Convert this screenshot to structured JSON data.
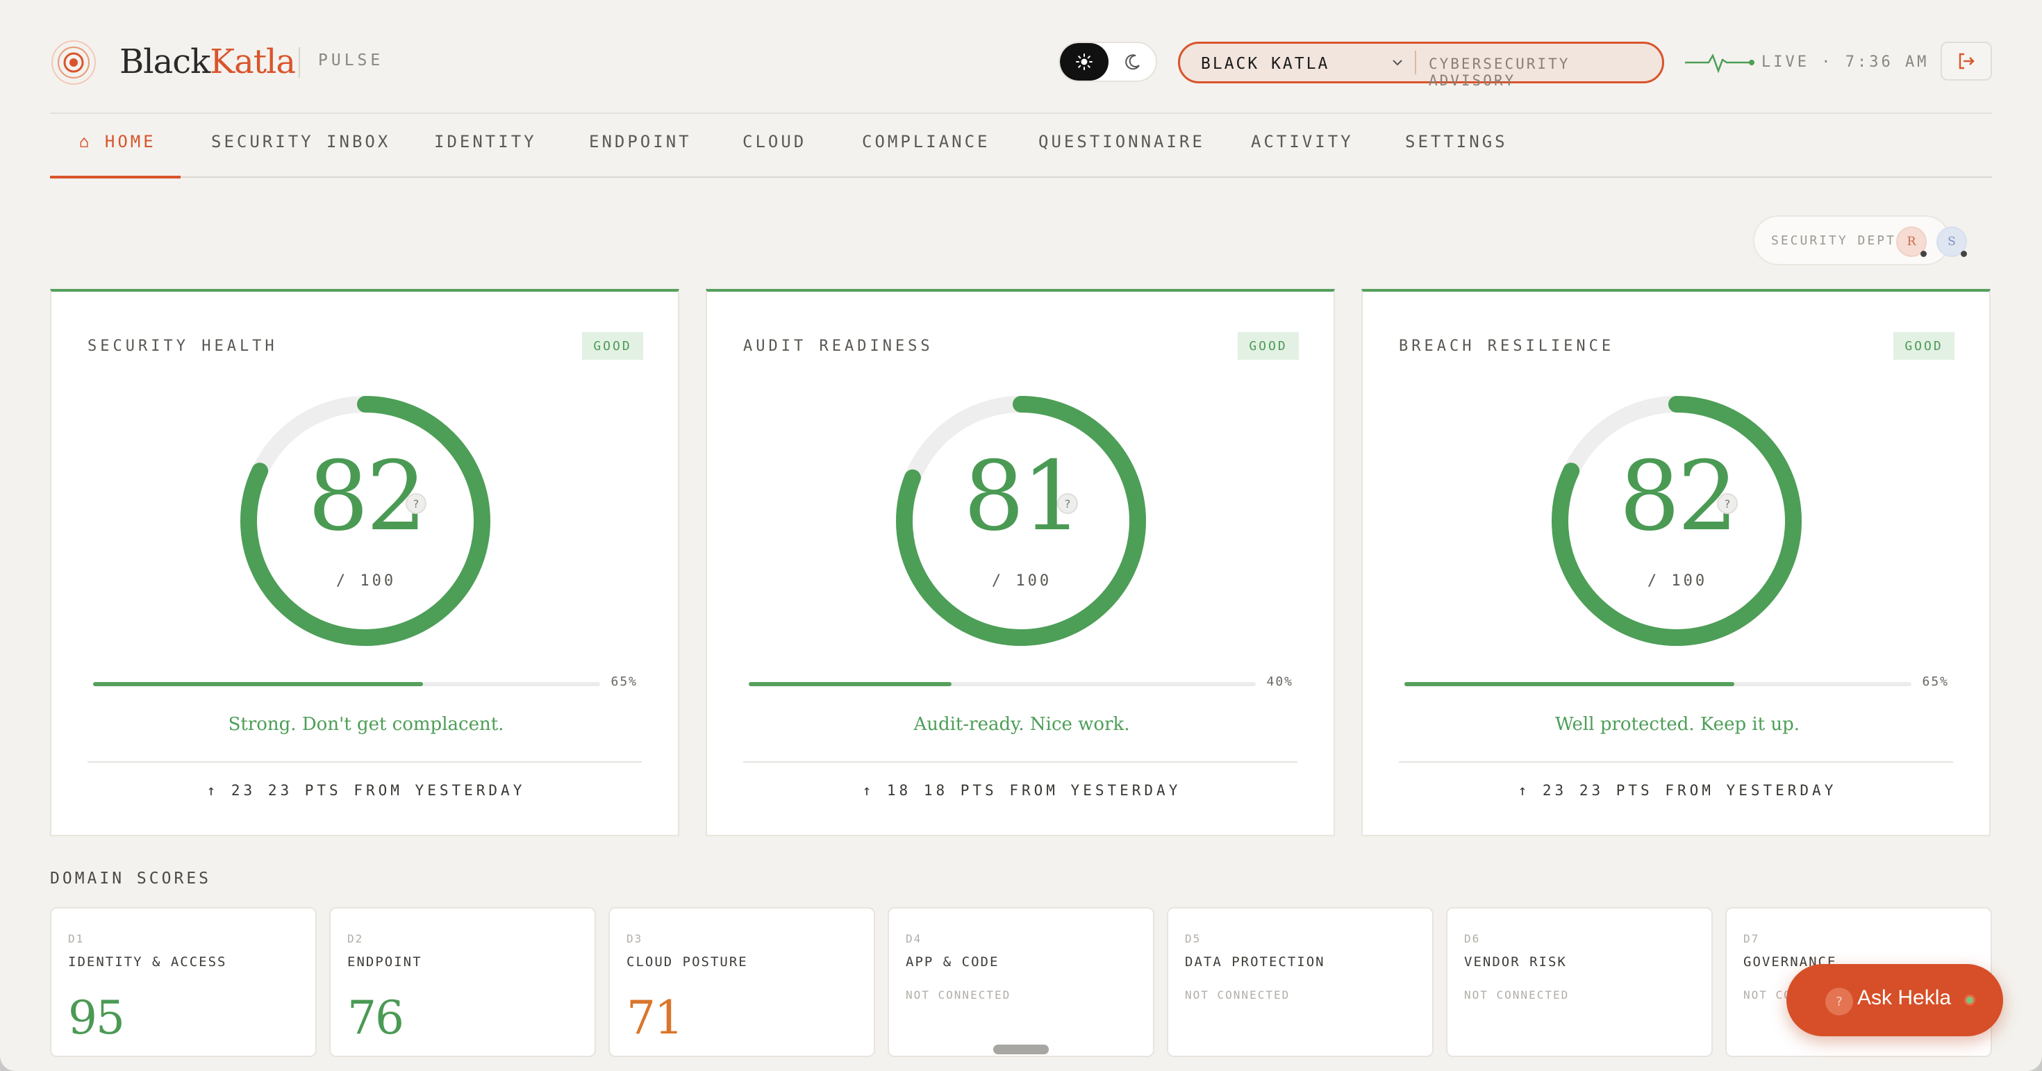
{
  "brand": {
    "name_main": "Black",
    "name_accent": "Katla",
    "product": "PULSE"
  },
  "header": {
    "org_name": "BLACK KATLA",
    "org_sub": "CYBERSECURITY ADVISORY",
    "live_label": "LIVE · 7:36 AM"
  },
  "nav": {
    "items": [
      {
        "label": "⌂ HOME"
      },
      {
        "label": "SECURITY INBOX"
      },
      {
        "label": "IDENTITY"
      },
      {
        "label": "ENDPOINT"
      },
      {
        "label": "CLOUD"
      },
      {
        "label": "COMPLIANCE"
      },
      {
        "label": "QUESTIONNAIRE"
      },
      {
        "label": "ACTIVITY"
      },
      {
        "label": "SETTINGS"
      }
    ]
  },
  "team": {
    "label": "SECURITY DEPT",
    "avatars": [
      "R",
      "S"
    ]
  },
  "scores": [
    {
      "title": "SECURITY HEALTH",
      "status": "GOOD",
      "value": "82",
      "score": 82,
      "max": "/ 100",
      "progress": 0.65,
      "progress_label": "65%",
      "tagline": "Strong. Don't get complacent.",
      "delta": "↑ 23 23 PTS FROM YESTERDAY"
    },
    {
      "title": "AUDIT READINESS",
      "status": "GOOD",
      "value": "81",
      "score": 81,
      "max": "/ 100",
      "progress": 0.4,
      "progress_label": "40%",
      "tagline": "Audit-ready. Nice work.",
      "delta": "↑ 18 18 PTS FROM YESTERDAY"
    },
    {
      "title": "BREACH RESILIENCE",
      "status": "GOOD",
      "value": "82",
      "score": 82,
      "max": "/ 100",
      "progress": 0.65,
      "progress_label": "65%",
      "tagline": "Well protected. Keep it up.",
      "delta": "↑ 23 23 PTS FROM YESTERDAY"
    }
  ],
  "domains": {
    "label": "DOMAIN SCORES",
    "items": [
      {
        "code": "D1",
        "name": "IDENTITY & ACCESS",
        "score": "95",
        "color": "#4a9a54"
      },
      {
        "code": "D2",
        "name": "ENDPOINT",
        "score": "76",
        "color": "#4a9a54"
      },
      {
        "code": "D3",
        "name": "CLOUD POSTURE",
        "score": "71",
        "color": "#d9762c"
      },
      {
        "code": "D4",
        "name": "APP & CODE",
        "status": "NOT CONNECTED"
      },
      {
        "code": "D5",
        "name": "DATA PROTECTION",
        "status": "NOT CONNECTED"
      },
      {
        "code": "D6",
        "name": "VENDOR RISK",
        "status": "NOT CONNECTED"
      },
      {
        "code": "D7",
        "name": "GOVERNANCE",
        "status": "NOT CONNECTED"
      }
    ]
  },
  "assistant": {
    "label": "Ask Hekla"
  },
  "colors": {
    "accent": "#d9542c",
    "good": "#4d9e57",
    "warn": "#d9762c",
    "background": "#f4f2ee"
  }
}
